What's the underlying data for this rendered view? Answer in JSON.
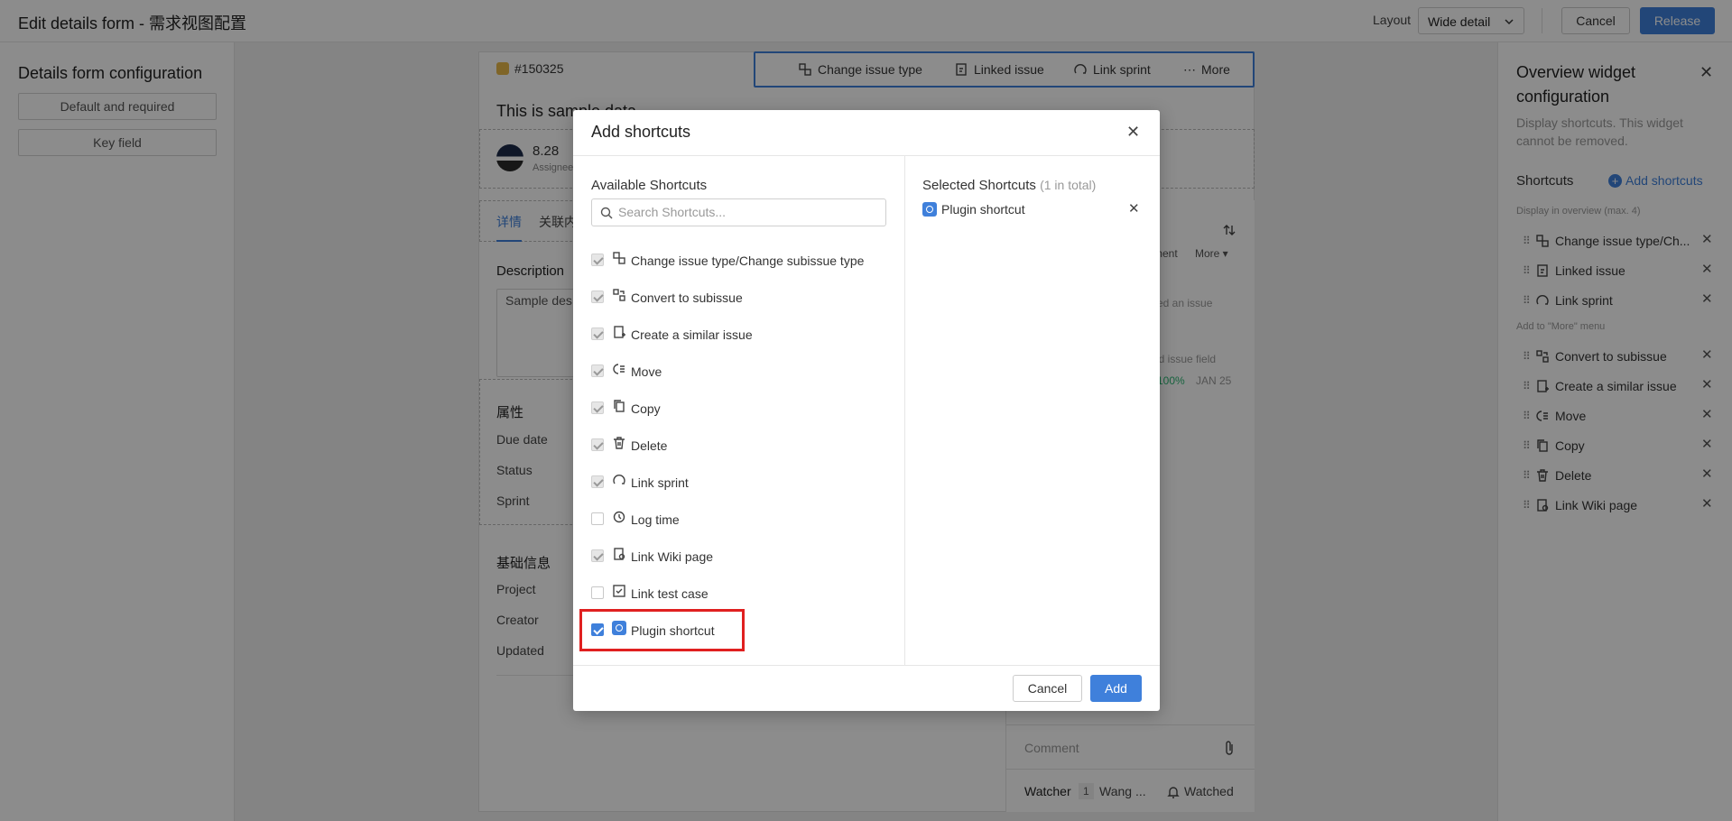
{
  "topbar": {
    "title": "Edit details form - 需求视图配置",
    "layout_label": "Layout",
    "layout_value": "Wide detail",
    "cancel": "Cancel",
    "release": "Release"
  },
  "left_panel": {
    "title": "Details form configuration",
    "buttons": [
      "Default and required",
      "Key field"
    ]
  },
  "issue": {
    "id": "#150325",
    "title": "This is sample data",
    "toolbar": [
      "Change issue type",
      "Linked issue",
      "Link sprint",
      "More"
    ],
    "avatar_value": "8.28",
    "avatar_caption": "Assignee",
    "tabs": [
      "详情",
      "关联内"
    ],
    "description_label": "Description",
    "description_text": "Sample des",
    "attributes_heading": "属性",
    "attributes": [
      "Due date",
      "Status",
      "Sprint"
    ],
    "basic_heading": "基础信息",
    "basic": [
      "Project",
      "Creator",
      "Updated"
    ],
    "activity": {
      "comment_tab": "ment",
      "more": "More",
      "created": "ed an issue",
      "changed": "ed issue field",
      "progress": "100%",
      "date": "JAN 25"
    },
    "comment_placeholder": "Comment",
    "watcher_label": "Watcher",
    "watcher_count": "1",
    "watcher_name": "Wang ...",
    "watched": "Watched"
  },
  "right_panel": {
    "title": "Overview widget configuration",
    "description": "Display shortcuts. This widget cannot be removed.",
    "shortcuts_label": "Shortcuts",
    "add_shortcuts": "Add shortcuts",
    "overview_hint": "Display in overview (max. 4)",
    "overview_items": [
      "Change issue type/Ch...",
      "Linked issue",
      "Link sprint"
    ],
    "more_hint": "Add to \"More\" menu",
    "more_items": [
      "Convert to subissue",
      "Create a similar issue",
      "Move",
      "Copy",
      "Delete",
      "Link Wiki page"
    ]
  },
  "dialog": {
    "title": "Add shortcuts",
    "available_heading": "Available Shortcuts",
    "search_placeholder": "Search Shortcuts...",
    "available": [
      {
        "label": "Change issue type/Change subissue type",
        "state": "checked-disabled",
        "icon": "change-type-icon"
      },
      {
        "label": "Convert to subissue",
        "state": "checked-disabled",
        "icon": "convert-icon"
      },
      {
        "label": "Create a similar issue",
        "state": "checked-disabled",
        "icon": "similar-issue-icon"
      },
      {
        "label": "Move",
        "state": "checked-disabled",
        "icon": "move-icon"
      },
      {
        "label": "Copy",
        "state": "checked-disabled",
        "icon": "copy-icon"
      },
      {
        "label": "Delete",
        "state": "checked-disabled",
        "icon": "trash-icon"
      },
      {
        "label": "Link sprint",
        "state": "checked-disabled",
        "icon": "sprint-icon"
      },
      {
        "label": "Log time",
        "state": "unchecked",
        "icon": "clock-icon"
      },
      {
        "label": "Link Wiki page",
        "state": "checked-disabled",
        "icon": "wiki-icon"
      },
      {
        "label": "Link test case",
        "state": "unchecked",
        "icon": "test-case-icon"
      },
      {
        "label": "Plugin shortcut",
        "state": "checked",
        "icon": "plugin-icon"
      }
    ],
    "selected_heading": "Selected Shortcuts",
    "selected_count": "(1 in total)",
    "selected": [
      "Plugin shortcut"
    ],
    "cancel": "Cancel",
    "add": "Add"
  },
  "colors": {
    "accent": "#3f80db",
    "highlight": "#e02020",
    "success": "#2bb673"
  }
}
